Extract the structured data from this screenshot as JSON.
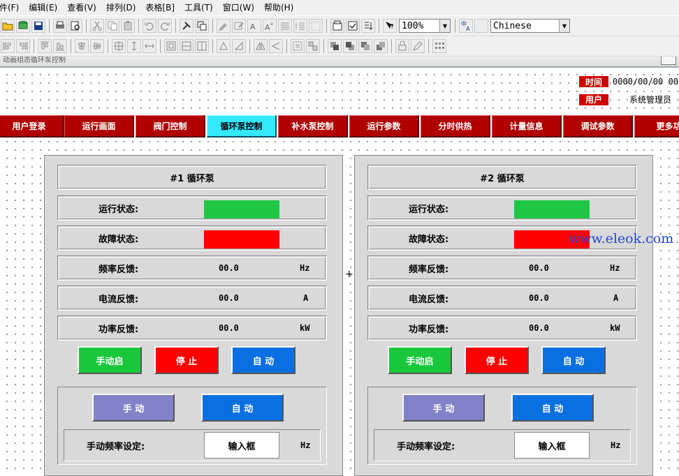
{
  "menu": [
    "件(F)",
    "编辑(E)",
    "查看(V)",
    "排列(D)",
    "表格[B]",
    "工具(T)",
    "窗口(W)",
    "帮助(H)"
  ],
  "toolbar": {
    "zoom": "100%",
    "language": "Chinese"
  },
  "doc_title": "动画组态循环泵控制",
  "header": {
    "time_label": "时间",
    "time_value": "0000/00/00 00",
    "user_label": "用户",
    "user_value": "系统管理员"
  },
  "nav": [
    "用户登录",
    "运行画面",
    "阀门控制",
    "循环泵控制",
    "补水泵控制",
    "运行参数",
    "分时供热",
    "计量信息",
    "调试参数",
    "更多功"
  ],
  "panels": [
    {
      "title": "#1 循环泵",
      "run_status": "运行状态:",
      "fault_status": "故障状态:",
      "freq_label": "频率反馈:",
      "freq_value": "00.0",
      "freq_unit": "Hz",
      "current_label": "电流反馈:",
      "current_value": "00.0",
      "current_unit": "A",
      "power_label": "功率反馈:",
      "power_value": "00.0",
      "power_unit": "kW",
      "btn_manual_start": "手动启",
      "btn_stop": "停 止",
      "btn_auto": "自 动",
      "btn_manual_mode": "手 动",
      "btn_auto_mode": "自 动",
      "freq_set_label": "手动频率设定:",
      "input_placeholder": "输入框",
      "set_unit": "Hz"
    },
    {
      "title": "#2 循环泵",
      "run_status": "运行状态:",
      "fault_status": "故障状态:",
      "freq_label": "频率反馈:",
      "freq_value": "00.0",
      "freq_unit": "Hz",
      "current_label": "电流反馈:",
      "current_value": "00.0",
      "current_unit": "A",
      "power_label": "功率反馈:",
      "power_value": "00.0",
      "power_unit": "kW",
      "btn_manual_start": "手动启",
      "btn_stop": "停 止",
      "btn_auto": "自 动",
      "btn_manual_mode": "手 动",
      "btn_auto_mode": "自 动",
      "freq_set_label": "手动频率设定:",
      "input_placeholder": "输入框",
      "set_unit": "Hz"
    }
  ],
  "watermark": "www.eleok.com",
  "colors": {
    "nav_bg": "#b00000",
    "nav_active": "#33e8ff",
    "run_lamp": "#1ec846",
    "fault_lamp": "#ff0000",
    "btn_blue": "#0a6fe0",
    "btn_purple": "#8282c8"
  }
}
